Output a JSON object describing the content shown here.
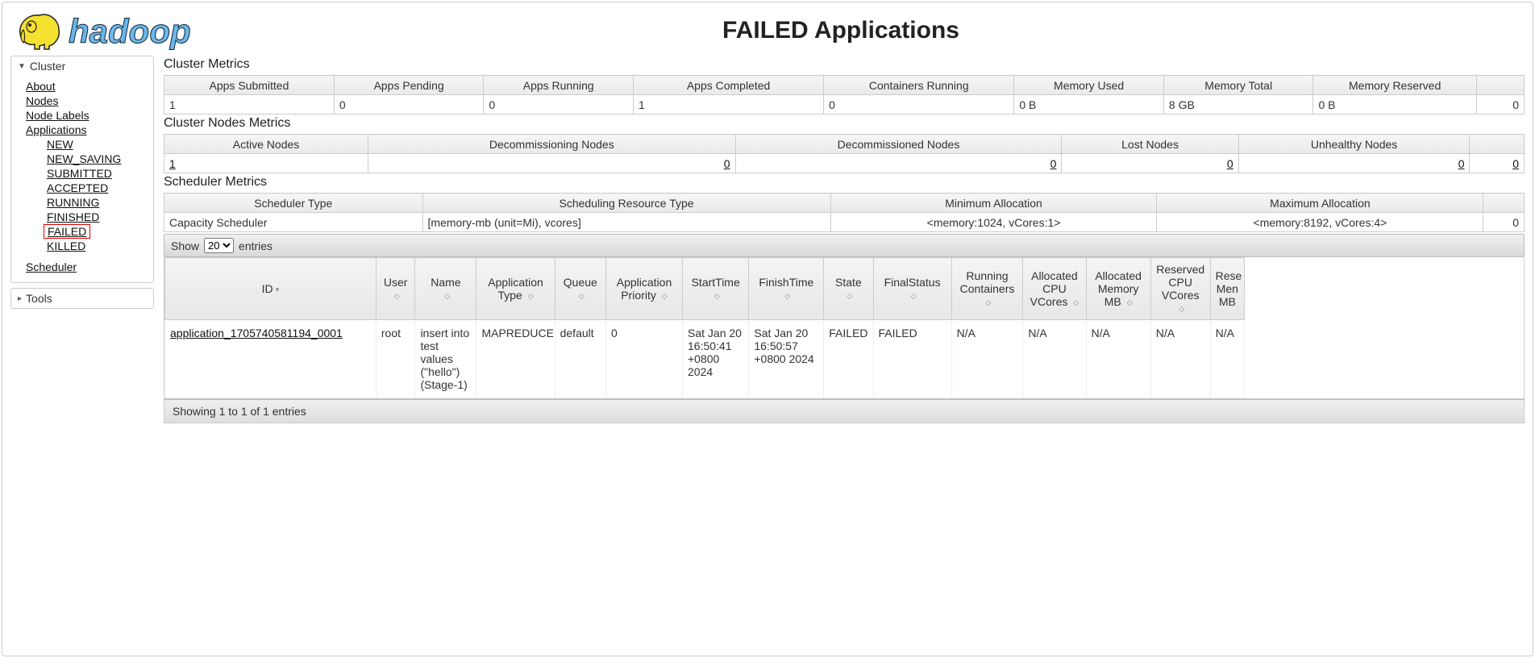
{
  "pageTitle": "FAILED Applications",
  "sidebar": {
    "clusterHeader": "Cluster",
    "toolsHeader": "Tools",
    "links": {
      "about": "About",
      "nodes": "Nodes",
      "nodeLabels": "Node Labels",
      "applications": "Applications",
      "scheduler": "Scheduler"
    },
    "appStates": {
      "new": "NEW",
      "newSaving": "NEW_SAVING",
      "submitted": "SUBMITTED",
      "accepted": "ACCEPTED",
      "running": "RUNNING",
      "finished": "FINISHED",
      "failed": "FAILED",
      "killed": "KILLED"
    }
  },
  "sections": {
    "clusterMetrics": "Cluster Metrics",
    "clusterNodesMetrics": "Cluster Nodes Metrics",
    "schedulerMetrics": "Scheduler Metrics"
  },
  "clusterMetrics": {
    "headers": {
      "appsSubmitted": "Apps Submitted",
      "appsPending": "Apps Pending",
      "appsRunning": "Apps Running",
      "appsCompleted": "Apps Completed",
      "containersRunning": "Containers Running",
      "memoryUsed": "Memory Used",
      "memoryTotal": "Memory Total",
      "memoryReserved": "Memory Reserved",
      "extra": ""
    },
    "values": {
      "appsSubmitted": "1",
      "appsPending": "0",
      "appsRunning": "0",
      "appsCompleted": "1",
      "containersRunning": "0",
      "memoryUsed": "0 B",
      "memoryTotal": "8 GB",
      "memoryReserved": "0 B",
      "extra": "0"
    }
  },
  "nodesMetrics": {
    "headers": {
      "active": "Active Nodes",
      "decommissioning": "Decommissioning Nodes",
      "decommissioned": "Decommissioned Nodes",
      "lost": "Lost Nodes",
      "unhealthy": "Unhealthy Nodes",
      "extra": ""
    },
    "values": {
      "active": "1",
      "decommissioning": "0",
      "decommissioned": "0",
      "lost": "0",
      "unhealthy": "0",
      "extra": "0"
    }
  },
  "schedulerMetrics": {
    "headers": {
      "type": "Scheduler Type",
      "resType": "Scheduling Resource Type",
      "minAlloc": "Minimum Allocation",
      "maxAlloc": "Maximum Allocation",
      "extra": ""
    },
    "values": {
      "type": "Capacity Scheduler",
      "resType": "[memory-mb (unit=Mi), vcores]",
      "minAlloc": "<memory:1024, vCores:1>",
      "maxAlloc": "<memory:8192, vCores:4>",
      "extra": "0"
    }
  },
  "dt": {
    "showLabel": "Show",
    "lengthValue": "20",
    "entriesLabel": "entries",
    "infoText": "Showing 1 to 1 of 1 entries"
  },
  "appsTable": {
    "headers": {
      "id": "ID",
      "user": "User",
      "name": "Name",
      "appType": "Application Type",
      "queue": "Queue",
      "priority": "Application Priority",
      "startTime": "StartTime",
      "finishTime": "FinishTime",
      "state": "State",
      "finalStatus": "FinalStatus",
      "runningContainers": "Running Containers",
      "allocCpu": "Allocated CPU VCores",
      "allocMem": "Allocated Memory MB",
      "reservedCpu": "Reserved CPU VCores",
      "reservedMem": "Rese Men MB"
    },
    "row": {
      "id": "application_1705740581194_0001",
      "user": "root",
      "name": "insert into test values (\"hello\")(Stage-1)",
      "appType": "MAPREDUCE",
      "queue": "default",
      "priority": "0",
      "startTime": "Sat Jan 20 16:50:41 +0800 2024",
      "finishTime": "Sat Jan 20 16:50:57 +0800 2024",
      "state": "FAILED",
      "finalStatus": "FAILED",
      "runningContainers": "N/A",
      "allocCpu": "N/A",
      "allocMem": "N/A",
      "reservedCpu": "N/A",
      "reservedMem": "N/A"
    }
  }
}
